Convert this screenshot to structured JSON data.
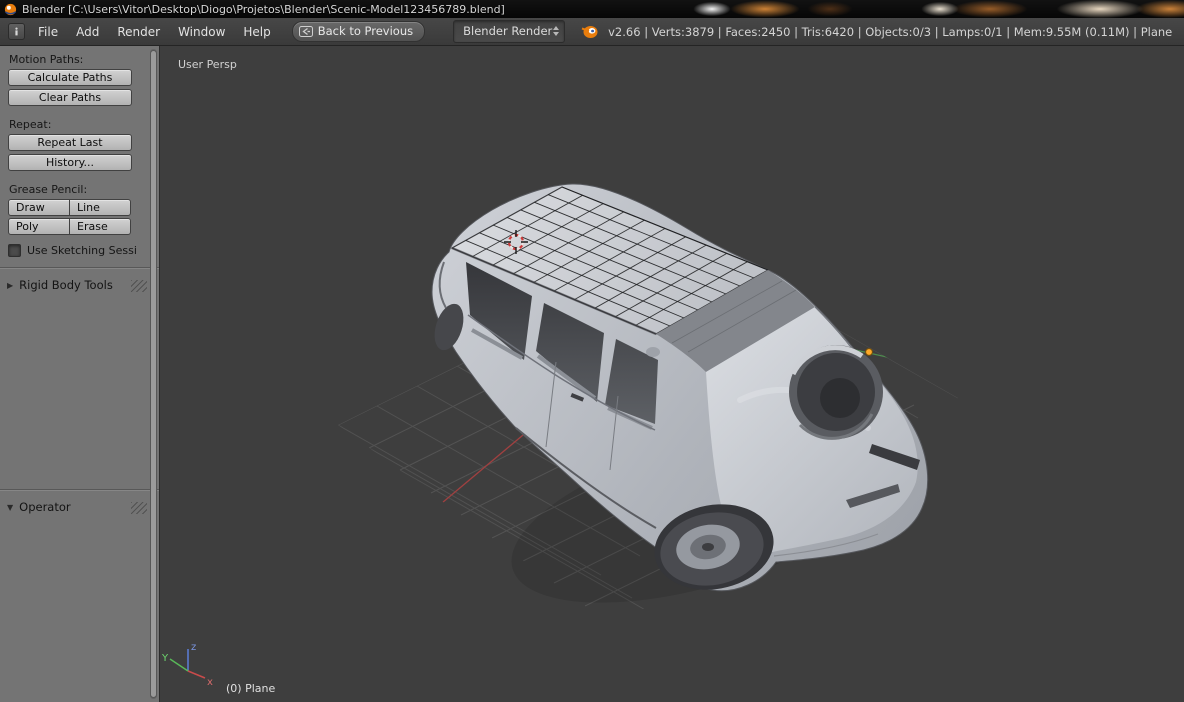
{
  "colors": {
    "accent-orange": "#e87d0d",
    "menubar-bg": "#3c3c3c",
    "toolshelf-bg": "#747474",
    "viewport-bg": "#3e3e3e",
    "button-bg": "#c2c2c2",
    "axis-x": "#cc4d4d",
    "axis-y": "#62c262",
    "axis-z": "#5b7fd8"
  },
  "titlebar": {
    "title": "Blender [C:\\Users\\Vitor\\Desktop\\Diogo\\Projetos\\Blender\\Scenic-Model123456789.blend]"
  },
  "menubar": {
    "menus": [
      {
        "label": "File"
      },
      {
        "label": "Add"
      },
      {
        "label": "Render"
      },
      {
        "label": "Window"
      },
      {
        "label": "Help"
      }
    ],
    "back_button": "Back to Previous",
    "render_engine": "Blender Render",
    "stats": "v2.66 | Verts:3879 | Faces:2450 | Tris:6420 | Objects:0/3 | Lamps:0/1 | Mem:9.55M (0.11M) | Plane"
  },
  "toolshelf": {
    "motion_paths": {
      "label": "Motion Paths:",
      "calculate": "Calculate Paths",
      "clear": "Clear Paths"
    },
    "repeat": {
      "label": "Repeat:",
      "repeat_last": "Repeat Last",
      "history": "History..."
    },
    "grease_pencil": {
      "label": "Grease Pencil:",
      "draw": "Draw",
      "line": "Line",
      "poly": "Poly",
      "erase": "Erase",
      "sketching": "Use Sketching Sessi"
    },
    "rigid_body": "Rigid Body Tools",
    "operator": "Operator"
  },
  "viewport": {
    "view_label": "User Persp",
    "object_label": "(0) Plane",
    "axes": {
      "x": "x",
      "y": "Y",
      "z": "z"
    }
  }
}
